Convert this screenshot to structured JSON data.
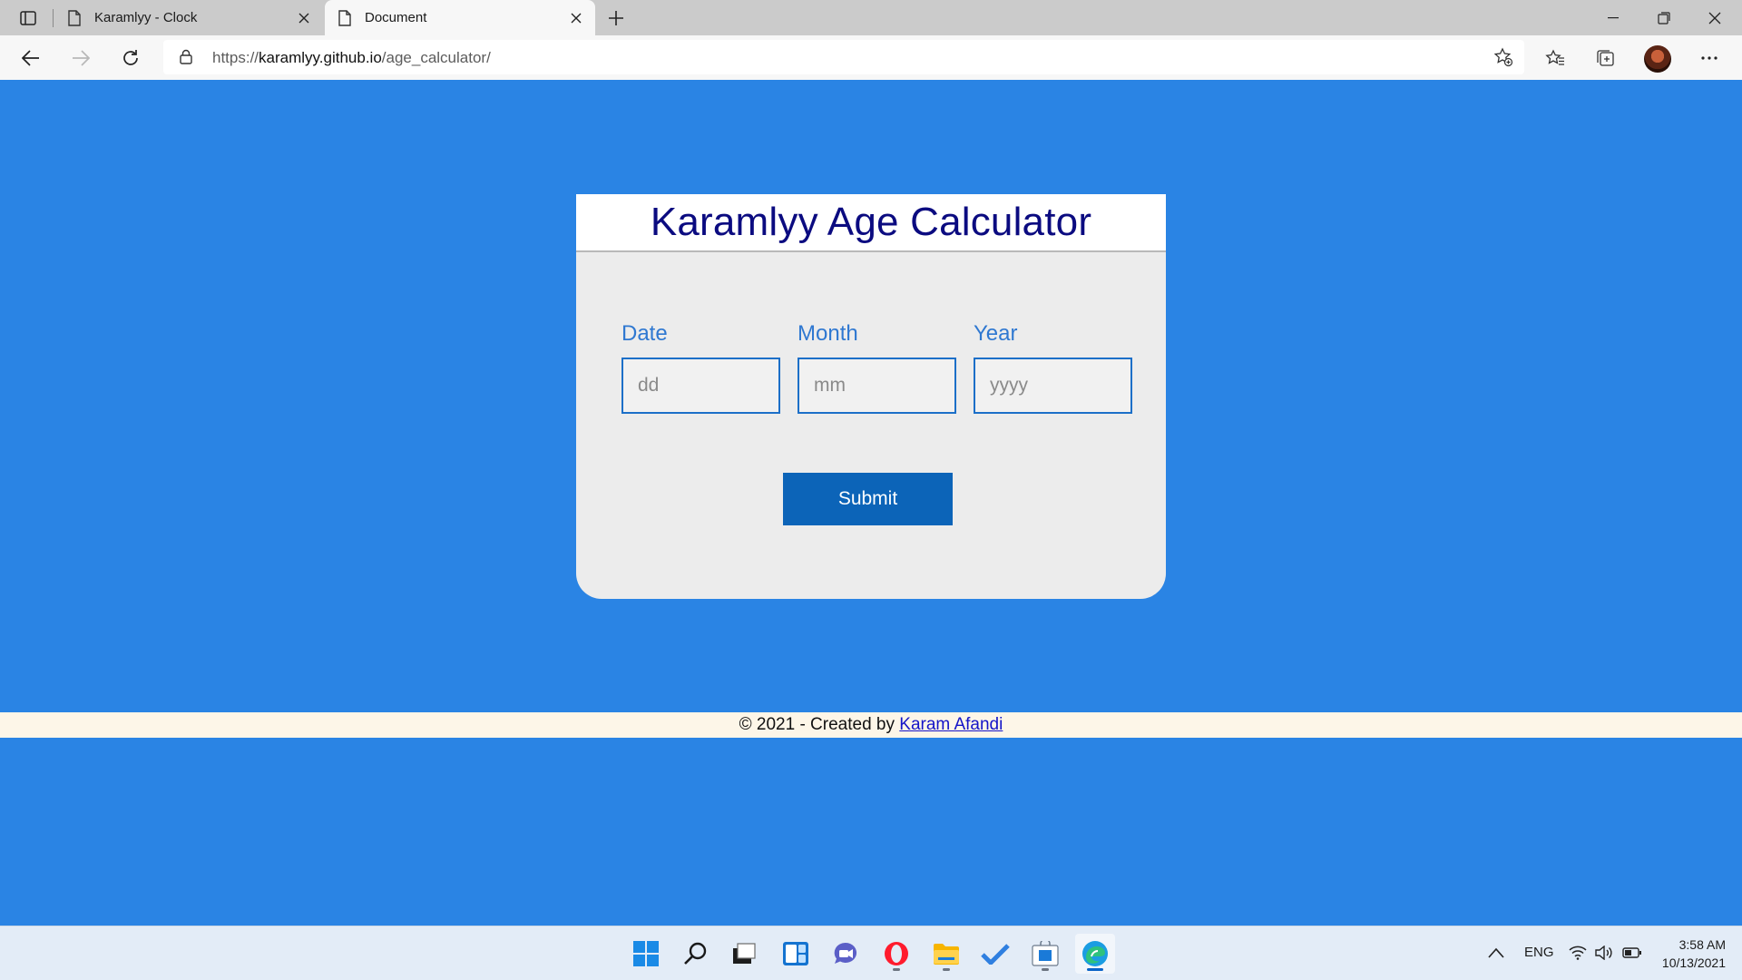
{
  "browser": {
    "tabs": [
      {
        "title": "Karamlyy - Clock",
        "active": false
      },
      {
        "title": "Document",
        "active": true
      }
    ],
    "url": {
      "scheme": "https://",
      "host": "karamlyy.github.io",
      "path": "/age_calculator/"
    }
  },
  "page": {
    "heading": "Karamlyy Age Calculator",
    "fields": [
      {
        "label": "Date",
        "placeholder": "dd"
      },
      {
        "label": "Month",
        "placeholder": "mm"
      },
      {
        "label": "Year",
        "placeholder": "yyyy"
      }
    ],
    "submit_label": "Submit",
    "footer": {
      "prefix": "© 2021 - Created by ",
      "author": "Karam Afandi"
    }
  },
  "taskbar": {
    "apps": [
      "start-icon",
      "search-icon",
      "task-view-icon",
      "widgets-icon",
      "chat-icon",
      "opera-icon",
      "file-explorer-icon",
      "todo-icon",
      "store-icon",
      "edge-icon"
    ],
    "language": "ENG",
    "time": "3:58 AM",
    "date": "10/13/2021"
  },
  "colors": {
    "page_background": "#2a84e4",
    "heading": "#0b0b80",
    "label": "#2f78d1",
    "button": "#0c64b8",
    "footer_background": "#fdf6e8"
  }
}
